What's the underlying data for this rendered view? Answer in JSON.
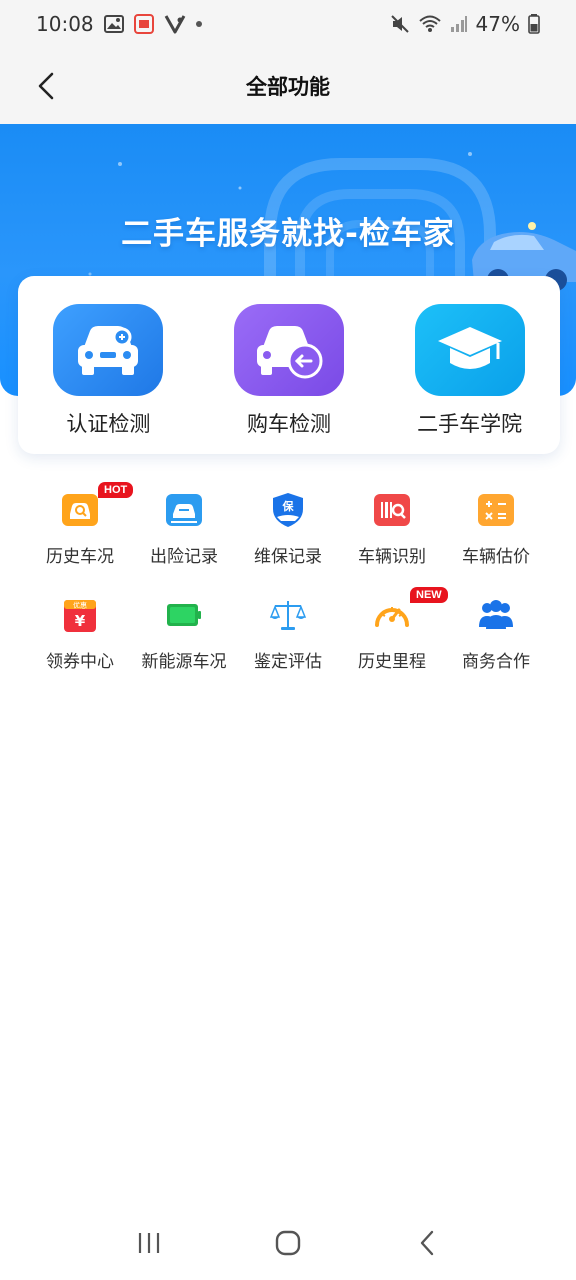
{
  "status_bar": {
    "time": "10:08",
    "battery": "47%",
    "left_icons": [
      "image-icon",
      "notification-icon",
      "vivaldi-icon"
    ],
    "right_icons": [
      "mute-icon",
      "wifi-icon",
      "signal-icon",
      "battery-icon"
    ]
  },
  "header": {
    "title": "全部功能",
    "back_icon": "chevron-left-icon"
  },
  "banner": {
    "title": "二手车服务就找-检车家",
    "colors": {
      "top": "#1a8cf5",
      "bottom": "#1890ff"
    }
  },
  "main_services": [
    {
      "label": "认证检测",
      "icon": "car-search-icon",
      "color": "#2b8cf2"
    },
    {
      "label": "购车检测",
      "icon": "car-return-icon",
      "color": "#8a5cf0"
    },
    {
      "label": "二手车学院",
      "icon": "graduation-cap-icon",
      "color": "#14aef0"
    }
  ],
  "grid": [
    {
      "label": "历史车况",
      "icon": "car-history-icon",
      "color": "#ffa41b",
      "badge": "HOT"
    },
    {
      "label": "出险记录",
      "icon": "accident-icon",
      "color": "#2c9cf0",
      "badge": ""
    },
    {
      "label": "维保记录",
      "icon": "shield-hand-icon",
      "color": "#1a73e8",
      "badge": ""
    },
    {
      "label": "车辆识别",
      "icon": "barcode-search-icon",
      "color": "#f04848",
      "badge": ""
    },
    {
      "label": "车辆估价",
      "icon": "calculator-icon",
      "color": "#ffa630",
      "badge": ""
    },
    {
      "label": "领券中心",
      "icon": "coupon-icon",
      "color": "#f0303c",
      "badge": ""
    },
    {
      "label": "新能源车况",
      "icon": "battery-icon",
      "color": "#22b24c",
      "badge": ""
    },
    {
      "label": "鉴定评估",
      "icon": "scale-icon",
      "color": "#2c9cf0",
      "badge": ""
    },
    {
      "label": "历史里程",
      "icon": "speedometer-icon",
      "color": "#ffa41b",
      "badge": "NEW"
    },
    {
      "label": "商务合作",
      "icon": "team-icon",
      "color": "#1a73e8",
      "badge": ""
    }
  ],
  "coupon_tag": "优惠",
  "shield_char": "保",
  "nav": [
    "recent-apps-icon",
    "home-icon",
    "back-icon"
  ]
}
